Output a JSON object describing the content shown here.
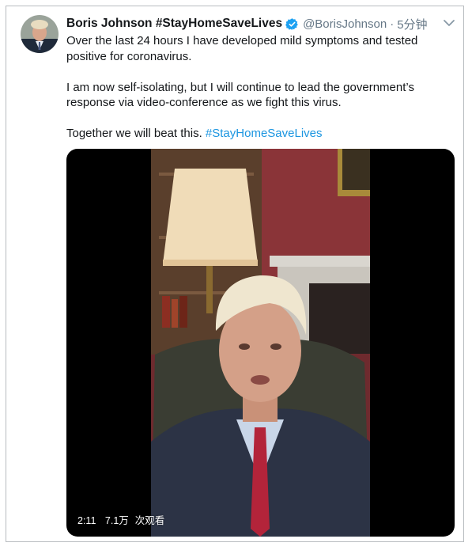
{
  "tweet": {
    "author_name": "Boris Johnson #StayHomeSaveLives",
    "handle": "@BorisJohnson",
    "separator": "·",
    "timestamp": "5分钟",
    "paragraphs": {
      "p1": "Over the last 24 hours I have developed mild symptoms and tested positive for coronavirus.",
      "p2": "I am now self-isolating, but I will continue to lead the government’s response via video-conference as we fight this virus.",
      "p3_text": "Together we will beat this. ",
      "p3_hashtag": "#StayHomeSaveLives"
    },
    "verified_icon": "verified-badge-icon",
    "menu_icon": "chevron-down-icon",
    "colors": {
      "text": "#14171a",
      "secondary": "#657786",
      "link": "#1b95e0",
      "verified": "#1da1f2"
    }
  },
  "video": {
    "duration": "2:11",
    "views": "7.1万",
    "views_suffix": "次观看"
  }
}
